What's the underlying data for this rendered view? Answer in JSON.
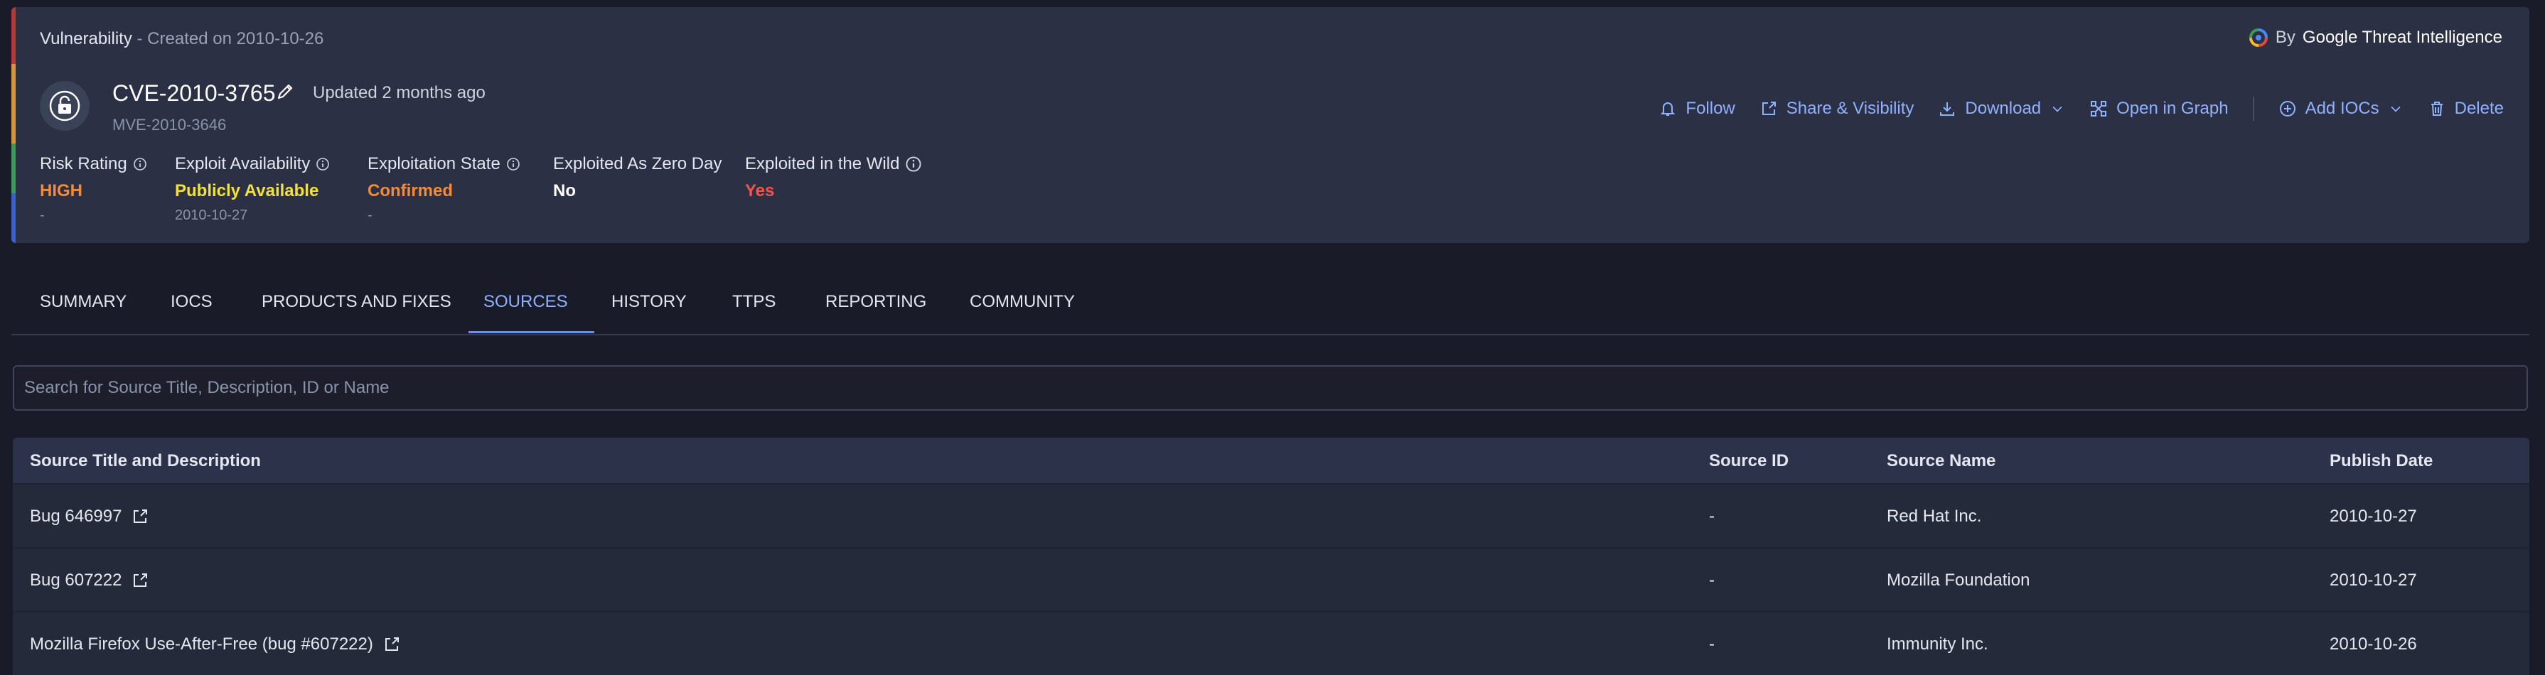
{
  "header": {
    "type_label": "Vulnerability",
    "created": " - Created on 2010-10-26",
    "by_prefix": "By",
    "by_name": "Google Threat Intelligence",
    "cve_id": "CVE-2010-3765",
    "updated": "Updated 2 months ago",
    "mve_id": "MVE-2010-3646"
  },
  "actions": {
    "follow": "Follow",
    "share": "Share & Visibility",
    "download": "Download",
    "open_graph": "Open in Graph",
    "add_iocs": "Add IOCs",
    "delete": "Delete"
  },
  "metrics": {
    "risk": {
      "label": "Risk Rating",
      "value": "HIGH",
      "sub": "-"
    },
    "exploit": {
      "label": "Exploit Availability",
      "value": "Publicly Available",
      "sub": "2010-10-27"
    },
    "state": {
      "label": "Exploitation State",
      "value": "Confirmed",
      "sub": "-"
    },
    "zero_day": {
      "label": "Exploited As Zero Day",
      "value": "No"
    },
    "wild": {
      "label": "Exploited in the Wild",
      "value": "Yes"
    }
  },
  "colors": {
    "high": "#f08c3a",
    "publicly_available": "#f2e13a",
    "confirmed": "#f08c3a",
    "no": "#ffffff",
    "yes": "#f0564e",
    "accent": "#8fb2ff"
  },
  "tabs": [
    "SUMMARY",
    "IOCS",
    "PRODUCTS AND FIXES",
    "SOURCES",
    "HISTORY",
    "TTPS",
    "REPORTING",
    "COMMUNITY"
  ],
  "active_tab": "SOURCES",
  "search": {
    "placeholder": "Search for Source Title, Description, ID or Name"
  },
  "table": {
    "columns": [
      "Source Title and Description",
      "Source ID",
      "Source Name",
      "Publish Date"
    ],
    "rows": [
      {
        "title": "Bug 646997",
        "id": "-",
        "name": "Red Hat Inc.",
        "date": "2010-10-27"
      },
      {
        "title": "Bug 607222",
        "id": "-",
        "name": "Mozilla Foundation",
        "date": "2010-10-27"
      },
      {
        "title": "Mozilla Firefox Use-After-Free (bug #607222)",
        "id": "-",
        "name": "Immunity Inc.",
        "date": "2010-10-26"
      }
    ]
  },
  "icons": {
    "lock": "unlocked-padlock-icon",
    "edit": "pencil-icon",
    "follow": "bell-icon",
    "share": "share-icon",
    "download": "download-icon",
    "graph": "graph-icon",
    "add": "plus-circle-icon",
    "delete": "trash-icon",
    "info": "info-icon",
    "external": "external-link-icon"
  }
}
